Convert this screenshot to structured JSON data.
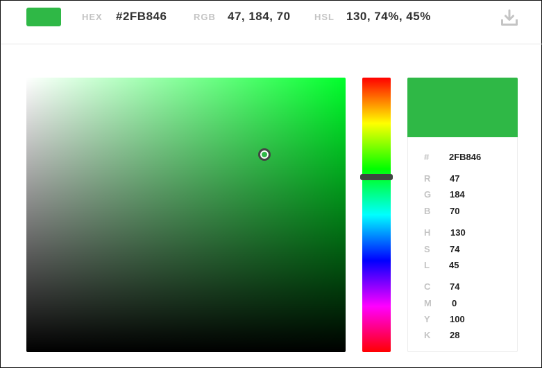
{
  "header": {
    "swatch_color": "#2FB846",
    "hex_label": "HEX",
    "hex_value": "#2FB846",
    "rgb_label": "RGB",
    "rgb_value": "47, 184, 70",
    "hsl_label": "HSL",
    "hsl_value": "130, 74%, 45%",
    "download_icon": "download-icon"
  },
  "picker": {
    "hue_color": "#00ff2b",
    "selected_color": "#2FB846",
    "hue": 130,
    "saturation_hsv": 0.74,
    "value_hsv": 0.72
  },
  "panel": {
    "hex": {
      "label": "#",
      "value": "2FB846"
    },
    "rgb": [
      {
        "label": "R",
        "value": "47"
      },
      {
        "label": "G",
        "value": "184"
      },
      {
        "label": "B",
        "value": "70"
      }
    ],
    "hsl": [
      {
        "label": "H",
        "value": "130"
      },
      {
        "label": "S",
        "value": "74"
      },
      {
        "label": "L",
        "value": "45"
      }
    ],
    "cmyk": [
      {
        "label": "C",
        "value": "74"
      },
      {
        "label": "M",
        "value": "0"
      },
      {
        "label": "Y",
        "value": "100"
      },
      {
        "label": "K",
        "value": "28"
      }
    ]
  }
}
